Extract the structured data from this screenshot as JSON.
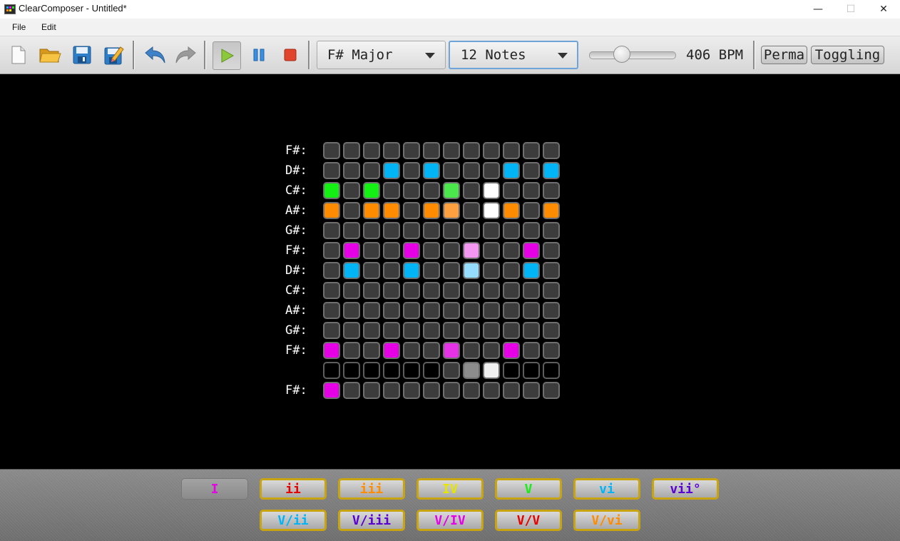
{
  "window": {
    "title": "ClearComposer - Untitled*",
    "minimize_icon": "minimize-icon",
    "maximize_icon": "maximize-icon",
    "close_icon": "close-icon",
    "minimize_glyph": "—",
    "maximize_glyph": "☐",
    "close_glyph": "✕"
  },
  "menu": {
    "items": [
      "File",
      "Edit"
    ]
  },
  "toolbar": {
    "key": "F# Major",
    "note_count": "12 Notes",
    "tempo_label": "406 BPM",
    "tempo_level": 0.35,
    "perma_label": "Perma",
    "toggling_label": "Toggling",
    "icons": [
      "new-file-icon",
      "open-folder-icon",
      "save-icon",
      "save-as-icon",
      "undo-icon",
      "redo-icon",
      "play-icon",
      "pause-icon",
      "stop-icon"
    ]
  },
  "colors": {
    "cell_off": "#3c3c3c",
    "cell_border": "#6f6f6f",
    "cell_black": "#000000",
    "blue": "#00b4f5",
    "green": "#14f014",
    "green_light": "#4be64b",
    "orange": "#ff8c00",
    "orange_light": "#ffa040",
    "white": "#ffffff",
    "magenta": "#e600e6",
    "magenta_light": "#e632e6",
    "pink": "#f296f2",
    "light_blue": "#96dcff",
    "grey_head": "#8c8c8c",
    "white_head": "#f0f0f0",
    "chord_border": "#c8a412"
  },
  "grid": {
    "rows": [
      {
        "label": "F#:",
        "cells": [
          "",
          "",
          "",
          "",
          "",
          "",
          "",
          "",
          "",
          "",
          "",
          ""
        ]
      },
      {
        "label": "D#:",
        "cells": [
          "",
          "",
          "",
          "blue",
          "",
          "blue",
          "",
          "",
          "",
          "blue",
          "",
          "blue"
        ]
      },
      {
        "label": "C#:",
        "cells": [
          "green",
          "",
          "green",
          "",
          "",
          "",
          "green_light",
          "",
          "white",
          "",
          "",
          ""
        ]
      },
      {
        "label": "A#:",
        "cells": [
          "orange",
          "",
          "orange",
          "orange",
          "",
          "orange",
          "orange_light",
          "",
          "white",
          "orange",
          "",
          "orange"
        ]
      },
      {
        "label": "G#:",
        "cells": [
          "",
          "",
          "",
          "",
          "",
          "",
          "",
          "",
          "",
          "",
          "",
          ""
        ]
      },
      {
        "label": "F#:",
        "cells": [
          "",
          "magenta",
          "",
          "",
          "magenta",
          "",
          "",
          "pink",
          "",
          "",
          "magenta",
          ""
        ]
      },
      {
        "label": "D#:",
        "cells": [
          "",
          "blue",
          "",
          "",
          "blue",
          "",
          "",
          "light_blue",
          "",
          "",
          "blue",
          ""
        ]
      },
      {
        "label": "C#:",
        "cells": [
          "",
          "",
          "",
          "",
          "",
          "",
          "",
          "",
          "",
          "",
          "",
          ""
        ]
      },
      {
        "label": "A#:",
        "cells": [
          "",
          "",
          "",
          "",
          "",
          "",
          "",
          "",
          "",
          "",
          "",
          ""
        ]
      },
      {
        "label": "G#:",
        "cells": [
          "",
          "",
          "",
          "",
          "",
          "",
          "",
          "",
          "",
          "",
          "",
          ""
        ]
      },
      {
        "label": "F#:",
        "cells": [
          "magenta",
          "",
          "",
          "magenta",
          "",
          "",
          "magenta_light",
          "",
          "",
          "magenta",
          "",
          ""
        ]
      },
      {
        "label": "",
        "cells": [
          "cell_black",
          "cell_black",
          "cell_black",
          "cell_black",
          "cell_black",
          "cell_black",
          "",
          "grey_head",
          "white_head",
          "cell_black",
          "cell_black",
          "cell_black"
        ]
      },
      {
        "label": "F#:",
        "cells": [
          "magenta",
          "",
          "",
          "",
          "",
          "",
          "",
          "",
          "",
          "",
          "",
          ""
        ]
      }
    ]
  },
  "chords": {
    "row1": [
      {
        "label": "I",
        "color": "#e600e6",
        "active": true
      },
      {
        "label": "ii",
        "color": "#e60000",
        "active": false
      },
      {
        "label": "iii",
        "color": "#ff8c00",
        "active": false
      },
      {
        "label": "IV",
        "color": "#e6e600",
        "active": false
      },
      {
        "label": "V",
        "color": "#14f014",
        "active": false
      },
      {
        "label": "vi",
        "color": "#00b4f5",
        "active": false
      },
      {
        "label": "vii°",
        "color": "#5a00d2",
        "active": false
      }
    ],
    "row2": [
      {
        "label": "V/ii",
        "color": "#00b4f5",
        "active": false
      },
      {
        "label": "V/iii",
        "color": "#5a00d2",
        "active": false
      },
      {
        "label": "V/IV",
        "color": "#e600e6",
        "active": false
      },
      {
        "label": "V/V",
        "color": "#e60000",
        "active": false
      },
      {
        "label": "V/vi",
        "color": "#ff8c00",
        "active": false
      }
    ]
  }
}
